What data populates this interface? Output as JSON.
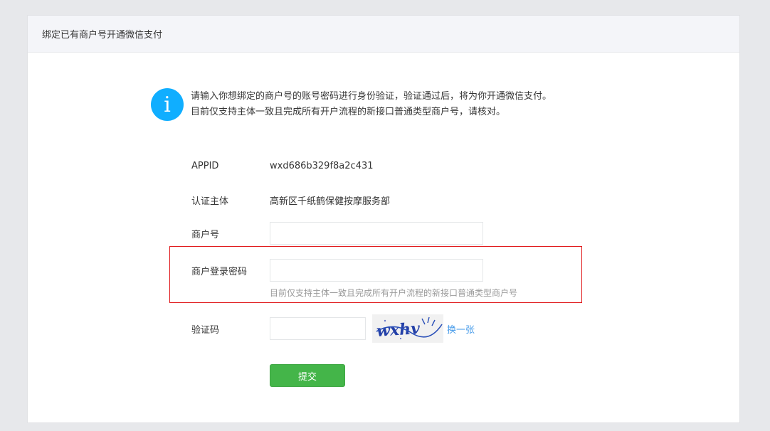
{
  "panel": {
    "title": "绑定已有商户号开通微信支付"
  },
  "notice": {
    "icon": "info-icon",
    "line1": "请输入你想绑定的商户号的账号密码进行身份验证，验证通过后，将为你开通微信支付。",
    "line2": "目前仅支持主体一致且完成所有开户流程的新接口普通类型商户号，请核对。"
  },
  "form": {
    "appid_label": "APPID",
    "appid_value": "wxd686b329f8a2c431",
    "subject_label": "认证主体",
    "subject_value": "高新区千纸鹤保健按摩服务部",
    "merchant_label": "商户号",
    "merchant_value": "",
    "password_label": "商户登录密码",
    "password_value": "",
    "password_hint": "目前仅支持主体一致且完成所有开户流程的新接口普通类型商户号",
    "captcha_label": "验证码",
    "captcha_value": "",
    "captcha_text": "wxhv",
    "captcha_change": "换一张",
    "submit_label": "提交"
  },
  "colors": {
    "accent": "#10aeff",
    "submit": "#44b549",
    "link": "#459ae9",
    "highlight": "#e0191b"
  }
}
